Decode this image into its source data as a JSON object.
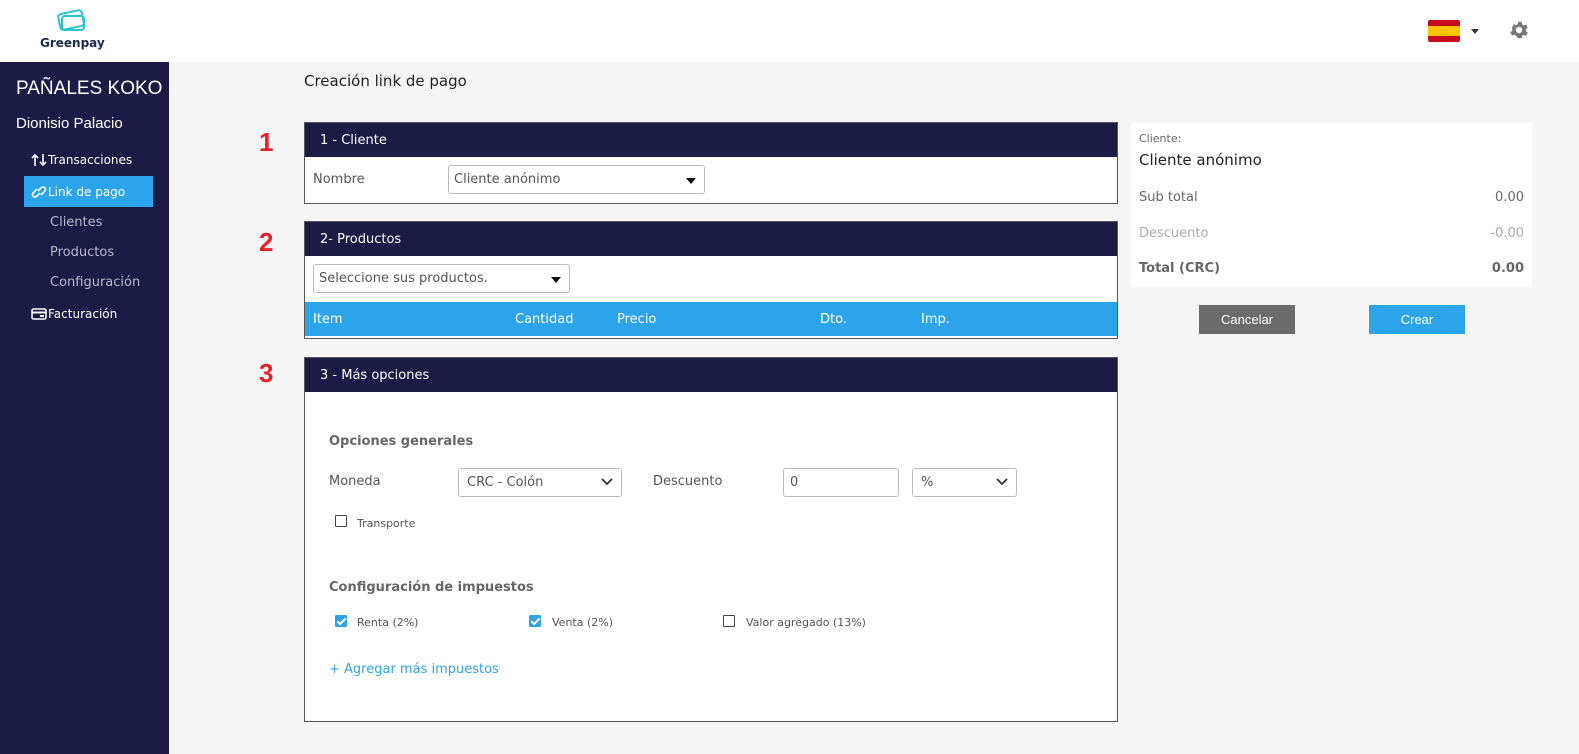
{
  "app": {
    "logo_text": "Greenpay"
  },
  "header": {
    "flag_icon": "spain-flag-icon",
    "settings_icon": "gear-icon"
  },
  "sidebar": {
    "company": "PAÑALES KOKO",
    "user": "Dionisio Palacio",
    "items": [
      {
        "label": "Transacciones",
        "icon": "arrows-updown-icon"
      },
      {
        "label": "Link de pago",
        "icon": "link-icon",
        "active": true
      },
      {
        "label": "Clientes"
      },
      {
        "label": "Productos"
      },
      {
        "label": "Configuración"
      },
      {
        "label": "Facturación",
        "icon": "card-icon"
      }
    ]
  },
  "main": {
    "title": "Creación link de pago",
    "steps": [
      "1",
      "2",
      "3"
    ],
    "cliente": {
      "header": "1 - Cliente",
      "nombre_label": "Nombre",
      "nombre_value": "Cliente anónimo"
    },
    "productos": {
      "header": "2- Productos",
      "select_placeholder": "Seleccione sus productos.",
      "columns": [
        "Item",
        "Cantidad",
        "Precio",
        "Dto.",
        "Imp."
      ]
    },
    "opciones": {
      "header": "3 - Más opciones",
      "general_title": "Opciones generales",
      "moneda_label": "Moneda",
      "moneda_value": "CRC - Colón",
      "descuento_label": "Descuento",
      "descuento_value": "0",
      "descuento_unit": "%",
      "transporte_label": "Transporte",
      "transporte_checked": false,
      "impuestos_title": "Configuración de impuestos",
      "impuestos": [
        {
          "label": "Renta (2%)",
          "checked": true
        },
        {
          "label": "Venta (2%)",
          "checked": true
        },
        {
          "label": "Valor agregado (13%)",
          "checked": false
        }
      ],
      "add_taxes_link": "+ Agregar más impuestos"
    }
  },
  "summary": {
    "client_label": "Cliente:",
    "client_value": "Cliente anónimo",
    "subtotal_label": "Sub total",
    "subtotal_value": "0.00",
    "descuento_label": "Descuento",
    "descuento_value": "-0.00",
    "total_label": "Total (CRC)",
    "total_value": "0.00"
  },
  "actions": {
    "cancel_label": "Cancelar",
    "create_label": "Crear"
  },
  "colors": {
    "navy": "#1b1b45",
    "accent": "#2ca4ec",
    "step_red": "#e8202a",
    "cancel_gray": "#6b6b6b"
  }
}
